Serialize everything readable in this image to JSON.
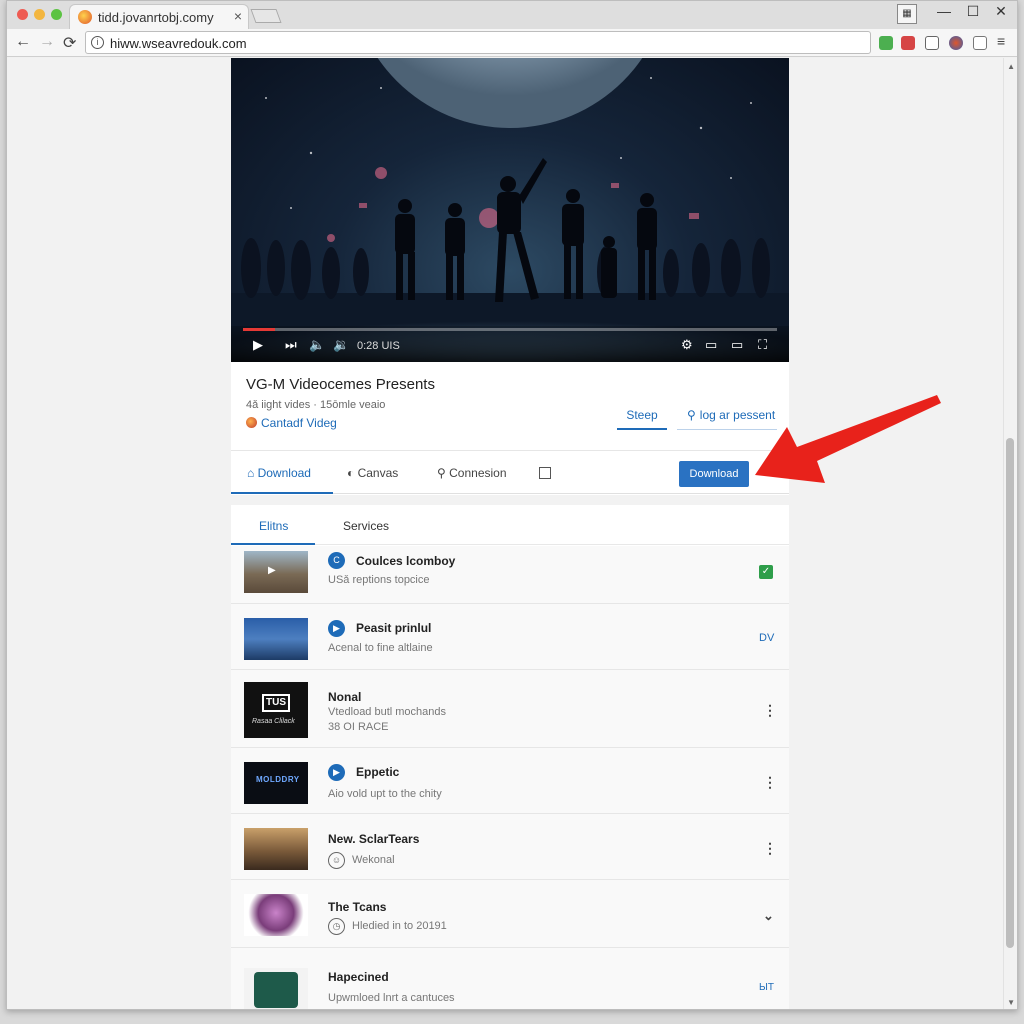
{
  "browser": {
    "tab_title": "tidd.jovanrtobj.comy",
    "tab_close": "×",
    "url": "hiww.wseavredouk.com",
    "nav": {
      "back": "←",
      "forward": "→",
      "reload": "⟳"
    },
    "window_controls": {
      "minimize": "—",
      "maximize": "☐",
      "close": "✕"
    },
    "menu_icon": "≡"
  },
  "video": {
    "time": "0:28 UIS",
    "progress": 0.06
  },
  "info": {
    "title": "VG-M Videocemes Presents",
    "meta": "4ǎ iight vides · 15ōmle veaio",
    "channel": "Cantadf Videg",
    "step_label": "Steep",
    "log_label": "log ar pessent"
  },
  "tabs": {
    "download": "Download",
    "canvas": "Canvas",
    "connection": "Connesion",
    "download_button": "Download"
  },
  "subtabs": {
    "first": "Elitns",
    "second": "Services"
  },
  "list": [
    {
      "title": "Coulces lcomboy",
      "sub": "USǎ reptions topcice",
      "action": "✓"
    },
    {
      "title": "Peasit prinlul",
      "sub": "Acenal to fine altlaine",
      "action": "DV"
    },
    {
      "title": "Nonal",
      "sub": "Vtedload butl mochands",
      "sub2": "38 OI RACE",
      "action": "⋮"
    },
    {
      "title": "Eppetic",
      "sub": "Aio vold upt to the chity",
      "action": "⋮"
    },
    {
      "title": "New. SclarTears",
      "sub": "Wekonal",
      "action": "⋮"
    },
    {
      "title": "The Tcans",
      "sub": "Hledied in to 20191",
      "action": "⌄"
    },
    {
      "title": "Hapecined",
      "sub": "Upwmloed lnrt a cantuces",
      "action": "ЫТ"
    }
  ],
  "thumb_texts": {
    "nonal_big": "TUS",
    "nonal_small": "Rasaa Clilack",
    "eppetic": "MOLDDRY"
  },
  "colors": {
    "accent": "#1e6bb8",
    "download_button": "#2a72c2",
    "check": "#2e9e4a",
    "arrow": "#e8221b"
  }
}
